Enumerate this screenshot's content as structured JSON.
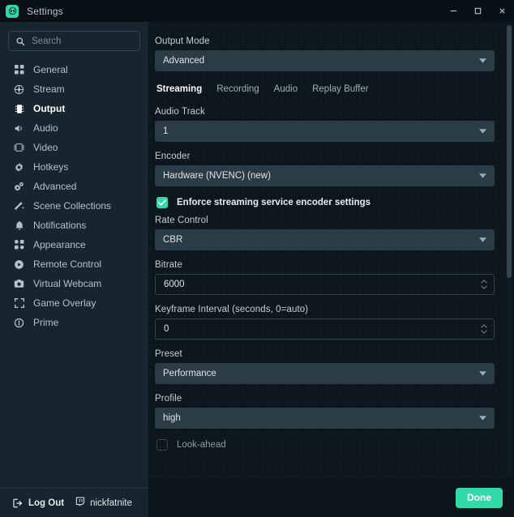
{
  "window": {
    "title": "Settings",
    "app_icon": "obs-app-icon",
    "controls": {
      "minimize": "minimize-icon",
      "maximize": "maximize-icon",
      "close": "close-icon"
    }
  },
  "colors": {
    "accent": "#31d8a8",
    "sidebar_bg": "#17252e",
    "main_bg": "#0c161c",
    "titlebar_bg": "#0a1116",
    "field_bg": "#2c3c46",
    "border": "#33454f",
    "text": "#c4ced4",
    "text_active": "#ffffff"
  },
  "sidebar": {
    "search": {
      "placeholder": "Search",
      "value": "",
      "icon": "search-icon"
    },
    "items": [
      {
        "label": "General",
        "icon": "grid-icon",
        "active": false
      },
      {
        "label": "Stream",
        "icon": "broadcast-icon",
        "active": false
      },
      {
        "label": "Output",
        "icon": "output-chip-icon",
        "active": true
      },
      {
        "label": "Audio",
        "icon": "speaker-icon",
        "active": false
      },
      {
        "label": "Video",
        "icon": "film-icon",
        "active": false
      },
      {
        "label": "Hotkeys",
        "icon": "gear-icon",
        "active": false
      },
      {
        "label": "Advanced",
        "icon": "gears-icon",
        "active": false
      },
      {
        "label": "Scene Collections",
        "icon": "scenes-icon",
        "active": false
      },
      {
        "label": "Notifications",
        "icon": "bell-icon",
        "active": false
      },
      {
        "label": "Appearance",
        "icon": "layout-icon",
        "active": false
      },
      {
        "label": "Remote Control",
        "icon": "play-circle-icon",
        "active": false
      },
      {
        "label": "Virtual Webcam",
        "icon": "camera-icon",
        "active": false
      },
      {
        "label": "Game Overlay",
        "icon": "expand-icon",
        "active": false
      },
      {
        "label": "Prime",
        "icon": "prime-icon",
        "active": false
      }
    ],
    "footer": {
      "logout_label": "Log Out",
      "logout_icon": "logout-icon",
      "username": "nickfatnite",
      "platform_icon": "twitch-icon"
    }
  },
  "main": {
    "output_mode": {
      "label": "Output Mode",
      "value": "Advanced",
      "caret_icon": "chevron-down-icon"
    },
    "tabs": [
      {
        "label": "Streaming",
        "active": true
      },
      {
        "label": "Recording",
        "active": false
      },
      {
        "label": "Audio",
        "active": false
      },
      {
        "label": "Replay Buffer",
        "active": false
      }
    ],
    "audio_track": {
      "label": "Audio Track",
      "value": "1",
      "caret_icon": "chevron-down-icon"
    },
    "encoder": {
      "label": "Encoder",
      "value": "Hardware (NVENC) (new)",
      "caret_icon": "chevron-down-icon"
    },
    "enforce": {
      "label": "Enforce streaming service encoder settings",
      "checked": true,
      "icon": "check-icon"
    },
    "rate_control": {
      "label": "Rate Control",
      "value": "CBR",
      "caret_icon": "chevron-down-icon"
    },
    "bitrate": {
      "label": "Bitrate",
      "value": "6000",
      "spinner_icon": "spinner-arrows-icon"
    },
    "keyframe": {
      "label": "Keyframe Interval (seconds, 0=auto)",
      "value": "0",
      "spinner_icon": "spinner-arrows-icon"
    },
    "preset": {
      "label": "Preset",
      "value": "Performance",
      "caret_icon": "chevron-down-icon"
    },
    "profile": {
      "label": "Profile",
      "value": "high",
      "caret_icon": "chevron-down-icon"
    },
    "lookahead": {
      "label": "Look-ahead",
      "checked": false
    },
    "scrollbar": "vertical-scrollbar"
  },
  "footer": {
    "done_label": "Done"
  }
}
